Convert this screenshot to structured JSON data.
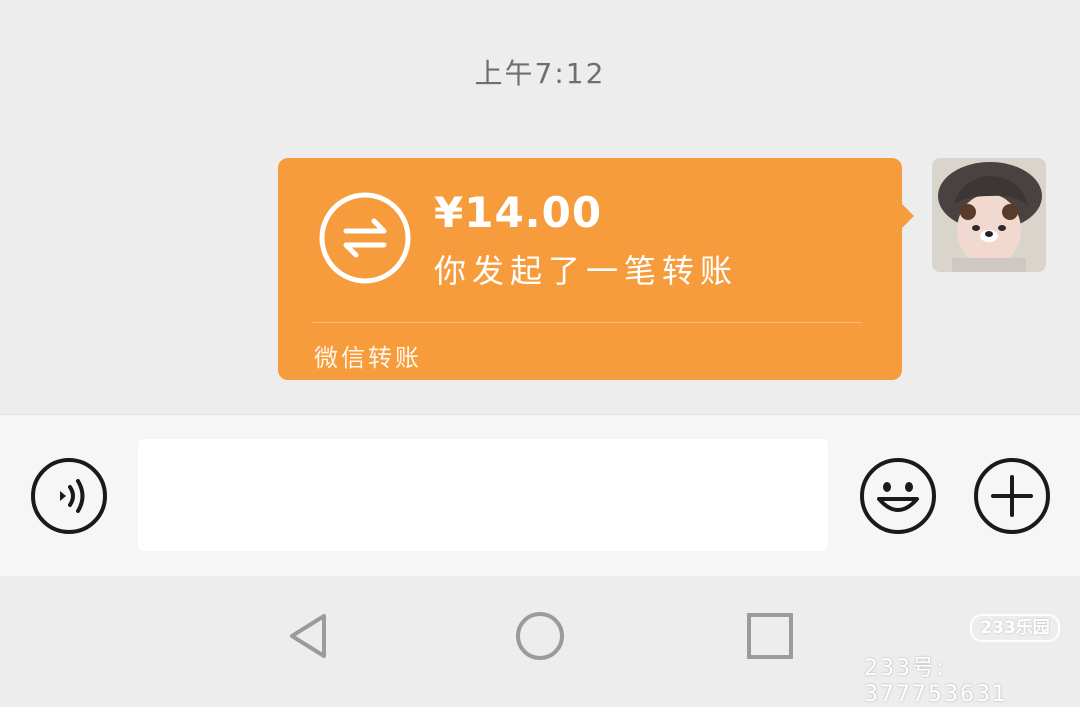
{
  "chat": {
    "timestamp": "上午7:12",
    "transfer": {
      "amount": "¥14.00",
      "description": "你发起了一笔转账",
      "footer": "微信转账",
      "card_color": "#f79c3d"
    },
    "avatar_icon": "user-avatar"
  },
  "input_bar": {
    "voice_icon": "voice-input-icon",
    "message_placeholder": "",
    "emoji_icon": "emoji-icon",
    "more_icon": "plus-icon"
  },
  "nav": {
    "back_icon": "back-triangle-icon",
    "home_icon": "home-circle-icon",
    "recent_icon": "recent-square-icon"
  },
  "watermark": {
    "badge": "233乐园",
    "text": "233号: 377753631"
  }
}
